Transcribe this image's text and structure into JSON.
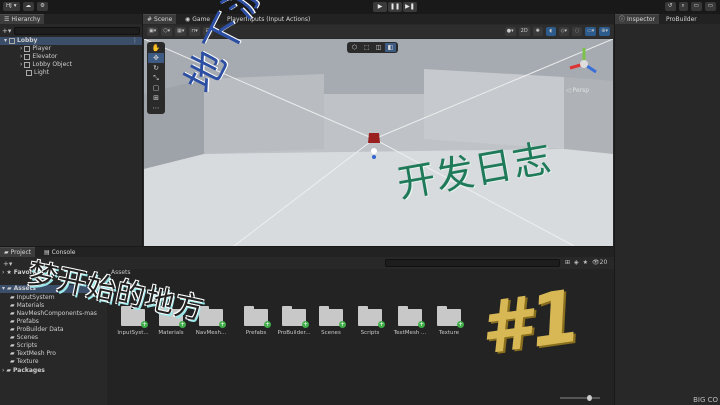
{
  "toolbar": {
    "account": "HJ",
    "play_icons": [
      "▶",
      "❚❚",
      "▶❚"
    ]
  },
  "hierarchy": {
    "tab": "Hierarchy",
    "items": [
      {
        "label": "Lobby"
      },
      {
        "label": "Player"
      },
      {
        "label": "Elevator"
      },
      {
        "label": "Lobby Object"
      },
      {
        "label": "Light"
      }
    ]
  },
  "scene": {
    "tabs": [
      "Scene",
      "Game",
      "PlayerInputs (Input Actions)"
    ],
    "toggle_2d": "2D",
    "persp_label": "Persp"
  },
  "inspector": {
    "tabs": [
      "Inspector",
      "ProBuilder"
    ]
  },
  "project": {
    "tabs": [
      "Project",
      "Console"
    ],
    "favorites": "Favorites",
    "assets_root": "Assets",
    "asset_path": "Assets",
    "tree": [
      "InputSystem",
      "Materials",
      "NavMeshComponents-mas",
      "Prefabs",
      "ProBuilder Data",
      "Scenes",
      "Scripts",
      "TextMesh Pro",
      "Texture"
    ],
    "packages": "Packages",
    "hidden_count": "20",
    "assets": [
      {
        "label": "InputSyst..."
      },
      {
        "label": "Materials"
      },
      {
        "label": "NavMesh..."
      },
      {
        "label": "Prefabs"
      },
      {
        "label": "ProBuilder..."
      },
      {
        "label": "Scenes"
      },
      {
        "label": "Scripts"
      },
      {
        "label": "TextMesh ..."
      },
      {
        "label": "Texture"
      }
    ]
  },
  "overlays": {
    "title_vertical": "地下游戏",
    "title_devlog": "开发日志",
    "title_dream": "梦开始的地方",
    "episode": "#1"
  },
  "colors": {
    "accent_blue": "#3d5b82",
    "devlog_green": "#1f7a59",
    "title_blue": "#2d4fa3",
    "episode_gold": "#d7b854"
  },
  "corner_text": "BIG CO"
}
